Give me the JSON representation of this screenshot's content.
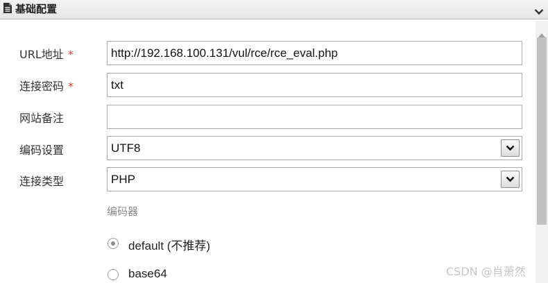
{
  "header": {
    "title": "基础配置",
    "doc_icon": "document-icon",
    "collapse_icon": "chevron-down-icon"
  },
  "form": {
    "url": {
      "label": "URL地址",
      "required_mark": "*",
      "value": "http://192.168.100.131/vul/rce/rce_eval.php"
    },
    "password": {
      "label": "连接密码",
      "required_mark": "*",
      "value": "txt"
    },
    "note": {
      "label": "网站备注",
      "value": ""
    },
    "encoding": {
      "label": "编码设置",
      "selected": "UTF8"
    },
    "type": {
      "label": "连接类型",
      "selected": "PHP"
    }
  },
  "encoder": {
    "label": "编码器",
    "options": [
      {
        "label": "default (不推荐)",
        "checked": true
      },
      {
        "label": "base64",
        "checked": false
      }
    ]
  },
  "watermark": "CSDN @肖萧然",
  "colors": {
    "required": "#e0402e",
    "border": "#aaaaaa",
    "scroll_thumb": "#c1c1c1"
  }
}
